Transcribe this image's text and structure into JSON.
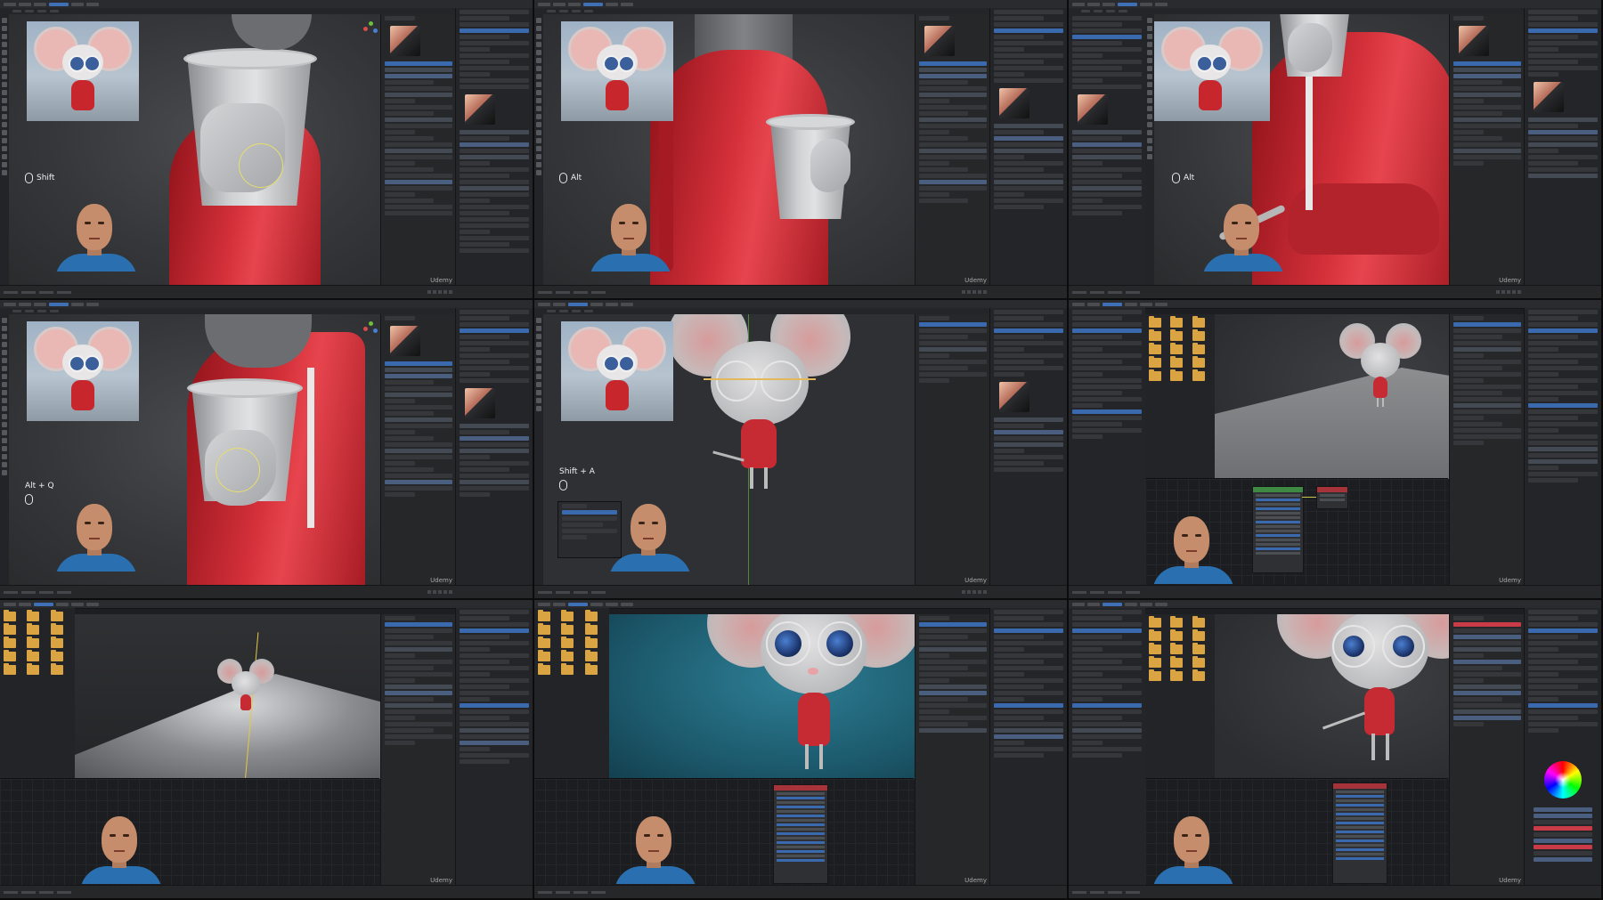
{
  "panels": [
    {
      "id": "p1",
      "shortcut": "Shift",
      "view": "Sculpt mode: cup and hand close-up"
    },
    {
      "id": "p2",
      "shortcut": "Alt",
      "view": "Sculpt mode: hoodie sleeve and cup"
    },
    {
      "id": "p3",
      "shortcut": "Alt",
      "view": "Sculpt mode: hoodie pocket"
    },
    {
      "id": "p4",
      "shortcut": "Alt + Q",
      "view": "Sculpt mode: hand on cup"
    },
    {
      "id": "p5",
      "shortcut": "Shift + A",
      "view": "Object mode: full mouse with glasses"
    },
    {
      "id": "p6",
      "shortcut": "",
      "view": "Layout: mouse on ground plane with node editor"
    },
    {
      "id": "p7",
      "shortcut": "",
      "view": "Lighting: mouse under spotlight"
    },
    {
      "id": "p8",
      "shortcut": "",
      "view": "Rendered: mouse on teal background"
    },
    {
      "id": "p9",
      "shortcut": "",
      "view": "Rendered: mouse close-up with color picker"
    }
  ],
  "watermark": "Udemy",
  "colors": {
    "hoodie": "#d4303a",
    "selection_blue": "#3f6fb5",
    "panel_bg": "#1d1e21",
    "teal_bg": "#1d5b6e"
  },
  "icons": [
    "mouse-icon",
    "folder-icon",
    "color-wheel-icon",
    "gizmo-icon"
  ]
}
